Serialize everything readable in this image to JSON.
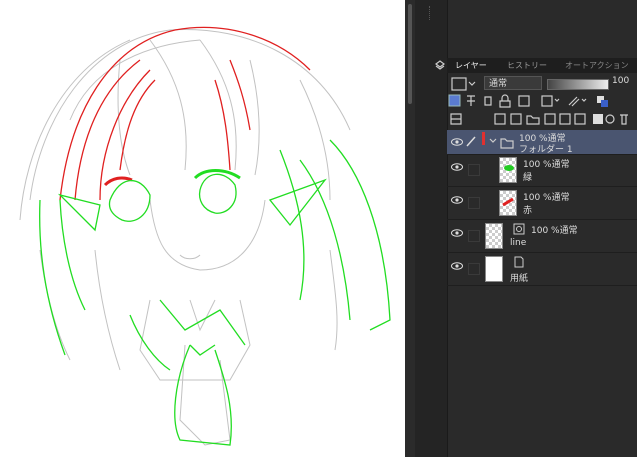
{
  "tabs": {
    "layer": "レイヤー",
    "history": "ヒストリー",
    "auto_action": "オートアクション"
  },
  "blend": {
    "mode": "通常",
    "opacity": "100"
  },
  "layers": [
    {
      "percent_mode": "100 %通常",
      "name": "フォルダー 1"
    },
    {
      "percent_mode": "100 %通常",
      "name": "緑"
    },
    {
      "percent_mode": "100 %通常",
      "name": "赤"
    },
    {
      "percent_mode": "100 %通常",
      "name": "line"
    },
    {
      "percent_mode": "",
      "name": "用紙"
    }
  ],
  "icons": [
    "eye-icon",
    "pen-icon",
    "folder-icon",
    "lock-icon",
    "trash-icon",
    "new-layer-icon",
    "mask-icon"
  ],
  "colors": {
    "red_line": "#e02020",
    "green_line": "#22dd22",
    "gray_line": "#bbbbbb",
    "selected_row": "#4a5570"
  }
}
